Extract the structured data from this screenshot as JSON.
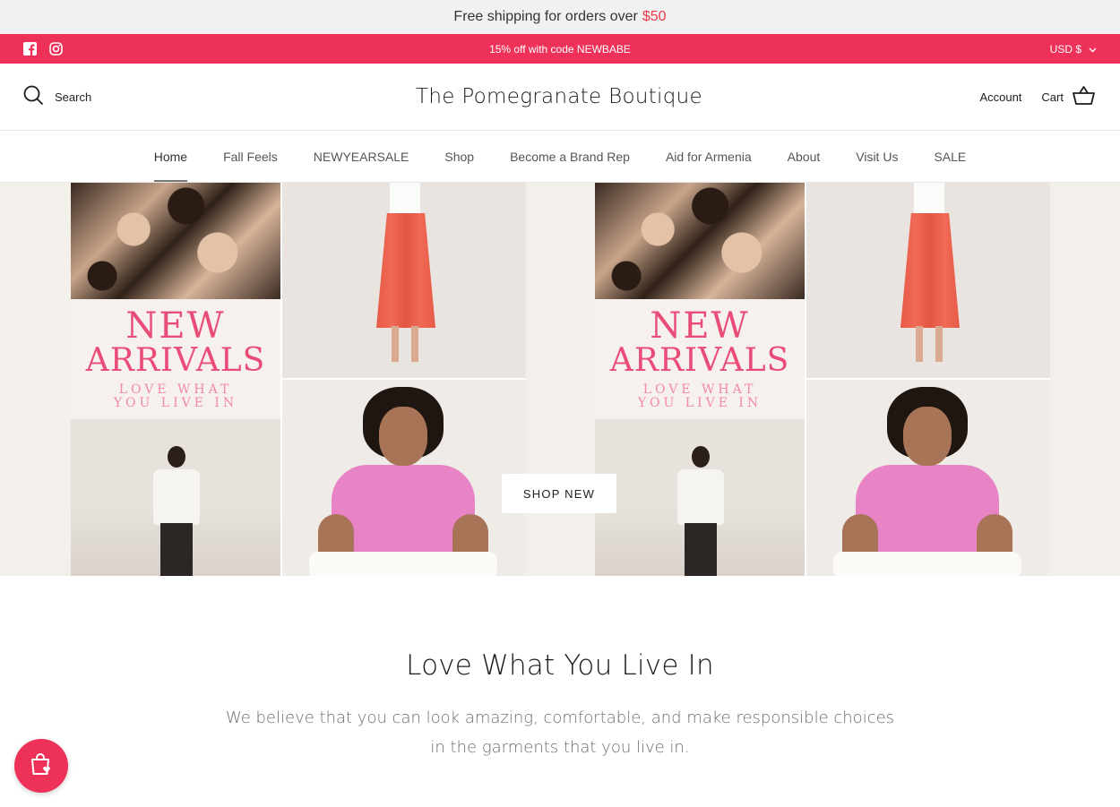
{
  "shipping_bar": {
    "text": "Free shipping for orders over",
    "amount": "$50"
  },
  "promo_bar": {
    "text": "15% off with code NEWBABE",
    "currency": "USD $",
    "social": [
      "facebook-icon",
      "instagram-icon"
    ]
  },
  "header": {
    "search_label": "Search",
    "logo": "The Pomegranate Boutique",
    "account_label": "Account",
    "cart_label": "Cart"
  },
  "nav": {
    "items": [
      {
        "label": "Home",
        "active": true
      },
      {
        "label": "Fall Feels"
      },
      {
        "label": "NEWYEARSALE"
      },
      {
        "label": "Shop"
      },
      {
        "label": "Become a Brand Rep"
      },
      {
        "label": "Aid for Armenia"
      },
      {
        "label": "About"
      },
      {
        "label": "Visit Us"
      },
      {
        "label": "SALE"
      }
    ]
  },
  "hero": {
    "headline_1": "NEW",
    "headline_2": "ARRIVALS",
    "tagline_1": "LOVE WHAT",
    "tagline_2": "YOU LIVE IN",
    "cta_label": "SHOP NEW"
  },
  "intro": {
    "title": "Love What You Live In",
    "body": "We believe that you can look amazing, comfortable, and make responsible choices in the garments that you live in."
  },
  "colors": {
    "accent": "#ee3159",
    "ship_amount": "#ef3a4a",
    "headline": "#e84c77"
  }
}
